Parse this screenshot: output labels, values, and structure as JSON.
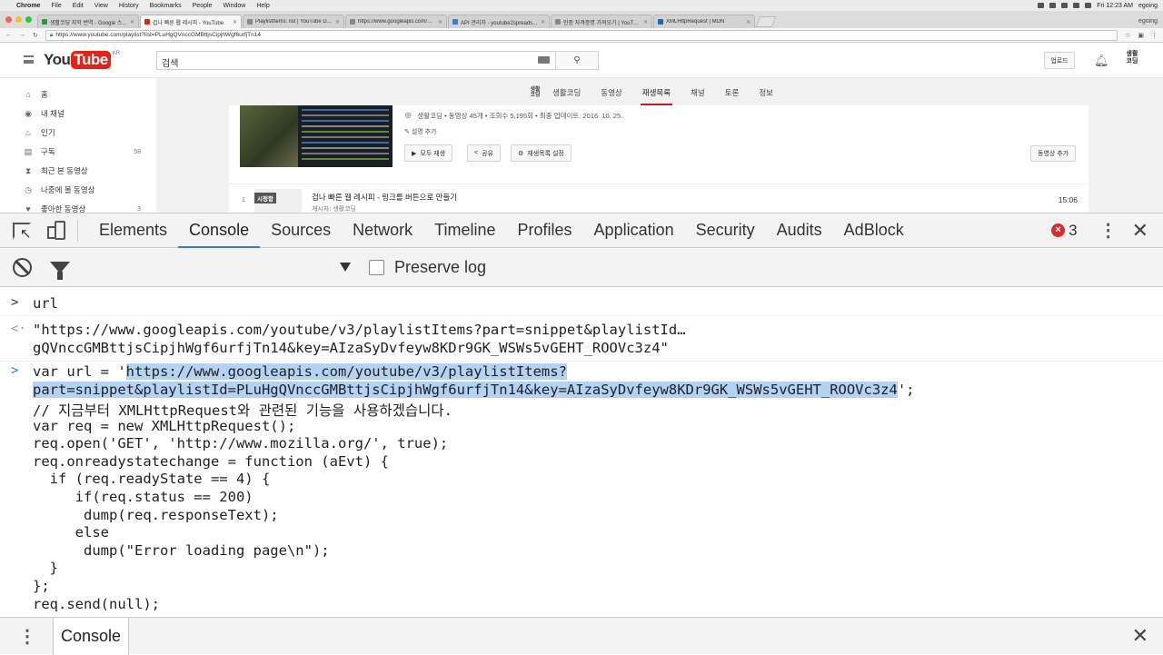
{
  "menubar": {
    "app": "Chrome",
    "items": [
      "File",
      "Edit",
      "View",
      "History",
      "Bookmarks",
      "People",
      "Window",
      "Help"
    ],
    "clock": "Fri 12:23 AM",
    "user": "egoing"
  },
  "tabs": [
    {
      "label": "생활코딩 자막 번역 - Google 스...",
      "color": "#1e9e3e",
      "active": false
    },
    {
      "label": "겁나 빠른 웹 레시피 - YouTube",
      "color": "#e62117",
      "active": true
    },
    {
      "label": "PlaylistItems: list | YouTube D...",
      "color": "#888888",
      "active": false
    },
    {
      "label": "https://www.googleapis.com/yo...",
      "color": "#888888",
      "active": false
    },
    {
      "label": "API 관리자 - youtube2spreads...",
      "color": "#3879d9",
      "active": false
    },
    {
      "label": "인증 자격증명 가져오기 | YouTub...",
      "color": "#888888",
      "active": false
    },
    {
      "label": "XMLHttpRequest | MDN",
      "color": "#1a6aa8",
      "active": false
    }
  ],
  "profile_name": "egoing",
  "address": {
    "url": "https://www.youtube.com/playlist?list=PLuHgQVnccGMBttjsCipjhWgf6urfjTn14"
  },
  "youtube": {
    "logo_you": "You",
    "logo_tube": "Tube",
    "logo_region": "KR",
    "search_value": "검색",
    "upload_label": "업로드",
    "avatar_text": "생활\n코딩",
    "sidebar": [
      {
        "icon": "⌂",
        "icon_name": "home-icon",
        "label": "홈",
        "count": ""
      },
      {
        "icon": "◉",
        "icon_name": "my-channel-icon",
        "label": "내 채널",
        "count": ""
      },
      {
        "icon": "♨",
        "icon_name": "trending-icon",
        "label": "인기",
        "count": ""
      },
      {
        "icon": "▤",
        "icon_name": "subscriptions-icon",
        "label": "구독",
        "count": "58"
      },
      {
        "icon": "⧗",
        "icon_name": "history-icon",
        "label": "최근 본 동영상",
        "count": ""
      },
      {
        "icon": "◷",
        "icon_name": "watch-later-icon",
        "label": "나중에 볼 동영상",
        "count": ""
      },
      {
        "icon": "♥",
        "icon_name": "liked-icon",
        "label": "좋아한 동영상",
        "count": "3"
      }
    ],
    "channel_badge": "생활\n코딩",
    "channel_tabs": [
      {
        "label": "생활코딩",
        "active": false
      },
      {
        "label": "동영상",
        "active": false
      },
      {
        "label": "재생목록",
        "active": true
      },
      {
        "label": "채널",
        "active": false
      },
      {
        "label": "토론",
        "active": false
      },
      {
        "label": "정보",
        "active": false
      }
    ],
    "playlist": {
      "meta": "생활코딩 • 동영상 45개 • 조회수 5,195회 • 최종 업데이트: 2016. 10. 25.",
      "desc": "설명 추가",
      "play_all": "모두 재생",
      "share": "공유",
      "settings": "재생목록 설정",
      "add_video": "동영상 추가"
    },
    "video": {
      "index": "1",
      "badge": "시청함",
      "title": "겁나 빠른 웹 레시피 - 링크를 버튼으로 만들기",
      "author": "게시자: 생활코딩",
      "duration": "15:06"
    }
  },
  "devtools": {
    "tabs": [
      {
        "label": "Elements",
        "active": false
      },
      {
        "label": "Console",
        "active": true
      },
      {
        "label": "Sources",
        "active": false
      },
      {
        "label": "Network",
        "active": false
      },
      {
        "label": "Timeline",
        "active": false
      },
      {
        "label": "Profiles",
        "active": false
      },
      {
        "label": "Application",
        "active": false
      },
      {
        "label": "Security",
        "active": false
      },
      {
        "label": "Audits",
        "active": false
      },
      {
        "label": "AdBlock",
        "active": false
      }
    ],
    "error_count": "3",
    "preserve_log_label": "Preserve log",
    "preserve_log_checked": false,
    "drawer_tab": "Console"
  },
  "console": {
    "input1": "url",
    "output1_line1": "\"https://www.googleapis.com/youtube/v3/playlistItems?part=snippet&playlistId…",
    "output1_line2": "gQVnccGMBttjsCipjhWgf6urfjTn14&key=AIzaSyDvfeyw8KDr9GK_WSWs5vGEHT_ROOVc3z4\"",
    "code_prefix": "var url = '",
    "code_url_line1": "https://www.googleapis.com/youtube/v3/playlistItems?",
    "code_url_line2": "part=snippet&playlistId=PLuHgQVnccGMBttjsCipjhWgf6urfjTn14&key=AIzaSyDvfeyw8KDr9GK_WSWs5vGEHT_ROOVc3z4",
    "code_suffix": "';",
    "code_lines": [
      "// 지금부터 XMLHttpRequest와 관련된 기능을 사용하겠습니다.",
      "var req = new XMLHttpRequest();",
      "req.open('GET', 'http://www.mozilla.org/', true);",
      "req.onreadystatechange = function (aEvt) {",
      "  if (req.readyState == 4) {",
      "     if(req.status == 200)",
      "      dump(req.responseText);",
      "     else",
      "      dump(\"Error loading page\\n\");",
      "  }",
      "};",
      "req.send(null);"
    ]
  }
}
